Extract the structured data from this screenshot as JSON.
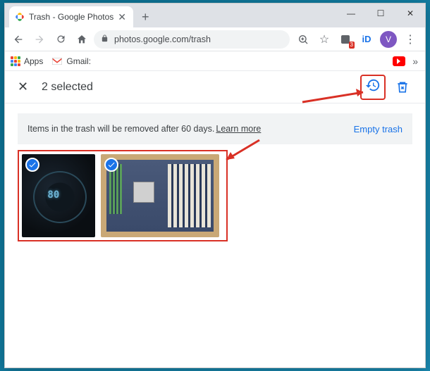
{
  "browser": {
    "tab_title": "Trash - Google Photos",
    "url": "photos.google.com/trash",
    "apps_label": "Apps",
    "gmail_label": "Gmail:",
    "ext_badge": "3",
    "avatar_initial": "V"
  },
  "selection": {
    "count_text": "2 selected"
  },
  "notice": {
    "message": "Items in the trash will be removed after 60 days.",
    "learn_more": "Learn more",
    "empty_trash": "Empty trash"
  },
  "photos": [
    {
      "id": "photo-1",
      "selected": true,
      "alt": "speedometer-photo"
    },
    {
      "id": "photo-2",
      "selected": true,
      "alt": "motherboard-photo"
    }
  ]
}
